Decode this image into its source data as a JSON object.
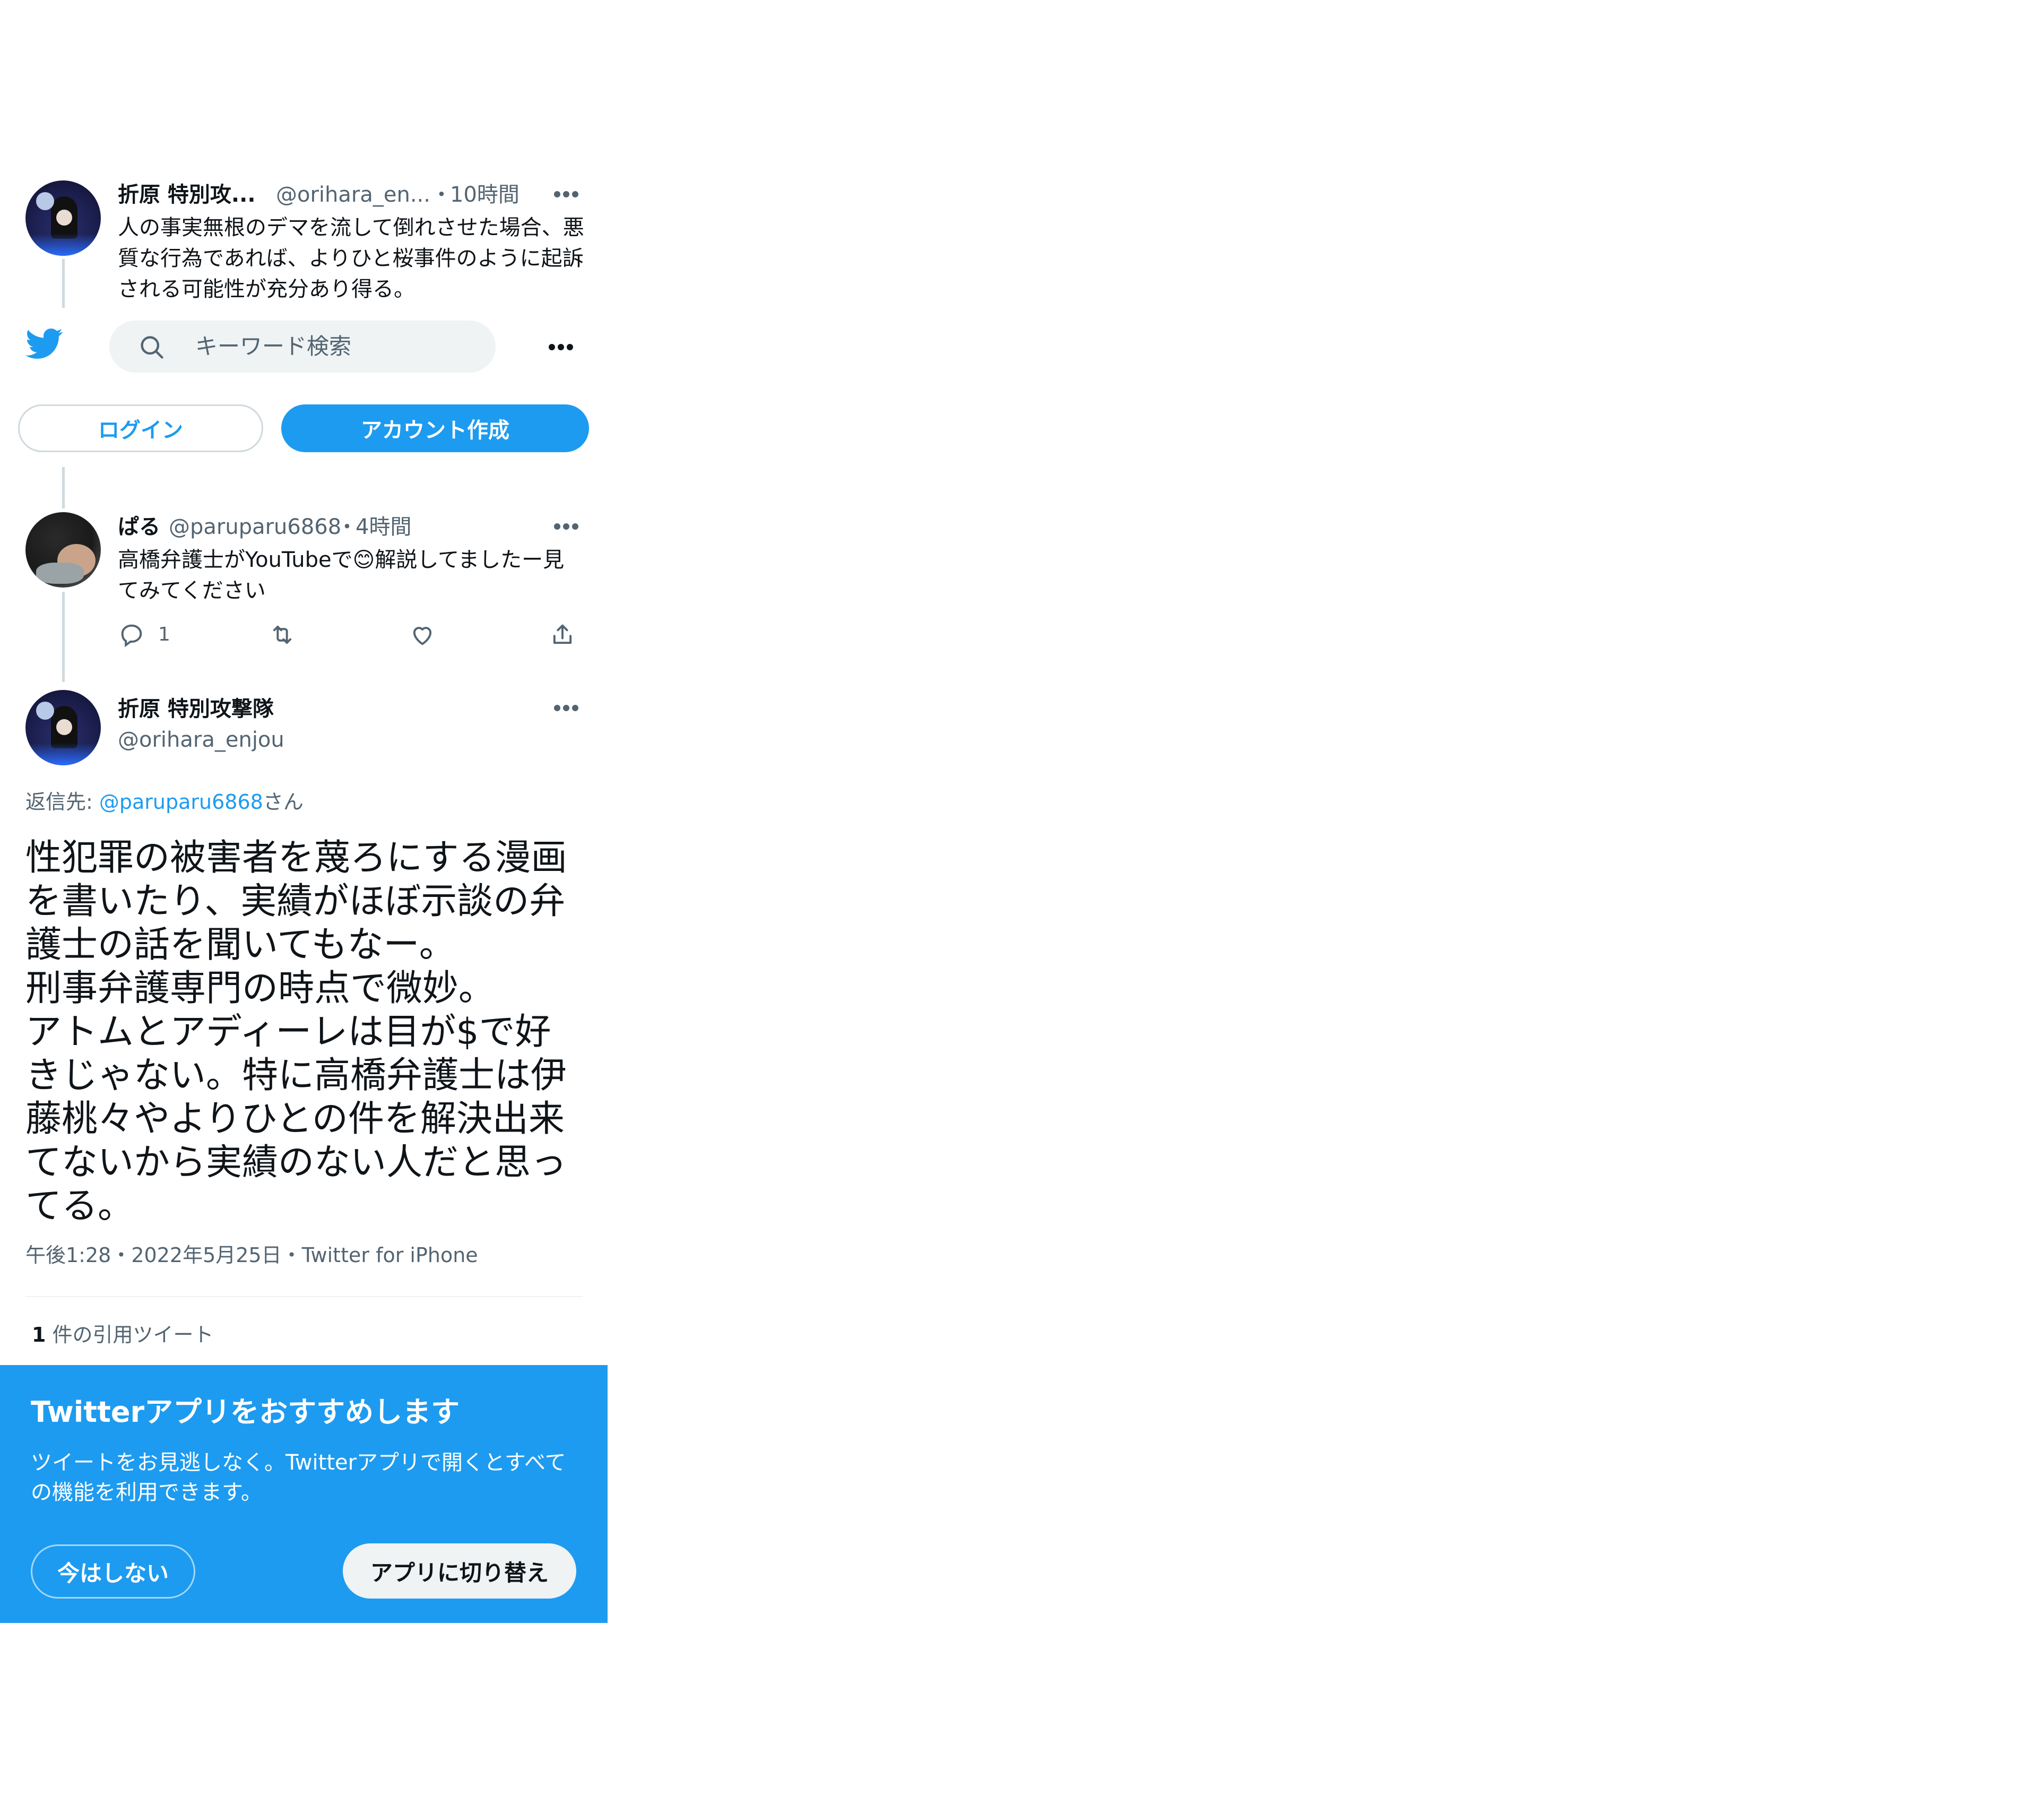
{
  "header": {
    "search_placeholder": "キーワード検索",
    "login_label": "ログイン",
    "signup_label": "アカウント作成"
  },
  "tweet1": {
    "name": "折原 特別攻...",
    "handle": "@orihara_en...",
    "sep": "・",
    "time": "10時間",
    "text": "人の事実無根のデマを流して倒れさせた場合、悪質な行為であれば、よりひと桜事件のように起訴される可能性が充分あり得る。"
  },
  "tweet2": {
    "name": "ぱる",
    "handle": "@paruparu6868",
    "sep": "・",
    "time": "4時間",
    "text_before": "高橋弁護士がYouTubeで",
    "emoji": "😊",
    "text_after": "解説してましたー見てみてください",
    "reply_count": "1"
  },
  "main": {
    "name": "折原 特別攻撃隊",
    "handle": "@orihara_enjou",
    "reply_prefix": "返信先: ",
    "reply_handle": "@paruparu6868",
    "reply_suffix": "さん",
    "text": "性犯罪の被害者を蔑ろにする漫画を書いたり、実績がほぼ示談の弁護士の話を聞いてもなー。\n刑事弁護専門の時点で微妙。\nアトムとアディーレは目が$で好きじゃない。特に高橋弁護士は伊藤桃々やよりひとの件を解決出来てないから実績のない人だと思ってる。",
    "meta_time": "午後1:28",
    "meta_sep": "・",
    "meta_date": "2022年5月25日",
    "meta_sep2": "・",
    "meta_source": "Twitter for iPhone",
    "quote_count": "1",
    "quote_label": "件の引用ツイート"
  },
  "banner": {
    "title": "Twitterアプリをおすすめします",
    "body": "ツイートをお見逃しなく。Twitterアプリで開くとすべての機能を利用できます。",
    "not_now": "今はしない",
    "switch_app": "アプリに切り替え",
    "bg_color": "#1d9bf0"
  },
  "colors": {
    "brand": "#1d9bf0",
    "muted": "#536471",
    "text": "#0f1419"
  }
}
